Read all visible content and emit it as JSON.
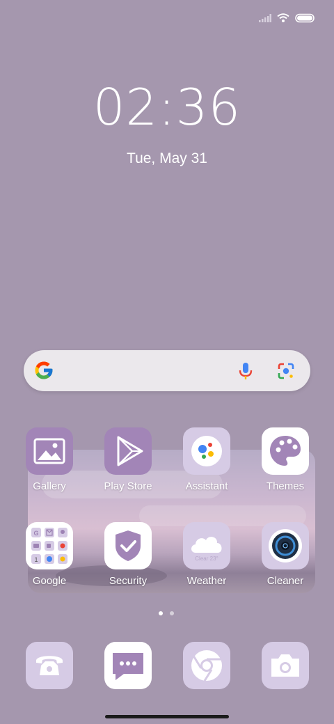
{
  "status_bar": {
    "icons": [
      "signal-icon",
      "wifi-icon",
      "battery-icon"
    ]
  },
  "lock": {
    "time": "02:36",
    "date": "Tue, May 31"
  },
  "search": {
    "icons": [
      "google-logo-icon",
      "mic-icon",
      "lens-icon"
    ]
  },
  "apps": [
    {
      "label": "Gallery",
      "icon": "gallery-icon"
    },
    {
      "label": "Play Store",
      "icon": "play-store-icon"
    },
    {
      "label": "Assistant",
      "icon": "assistant-icon"
    },
    {
      "label": "Themes",
      "icon": "themes-icon"
    },
    {
      "label": "Google",
      "icon": "google-folder-icon"
    },
    {
      "label": "Security",
      "icon": "security-icon"
    },
    {
      "label": "Weather",
      "icon": "weather-icon",
      "sub": "Clear 23°"
    },
    {
      "label": "Cleaner",
      "icon": "cleaner-icon"
    }
  ],
  "dock": [
    {
      "icon": "phone-icon"
    },
    {
      "icon": "messages-icon"
    },
    {
      "icon": "chrome-icon"
    },
    {
      "icon": "camera-icon"
    }
  ],
  "page_indicator": {
    "count": 2,
    "active": 1
  },
  "colors": {
    "wallpaper": "#a597ae",
    "tile_light": "#d4c8e3",
    "tile_dark": "#9d83b4",
    "accent": "#a48ab9"
  }
}
